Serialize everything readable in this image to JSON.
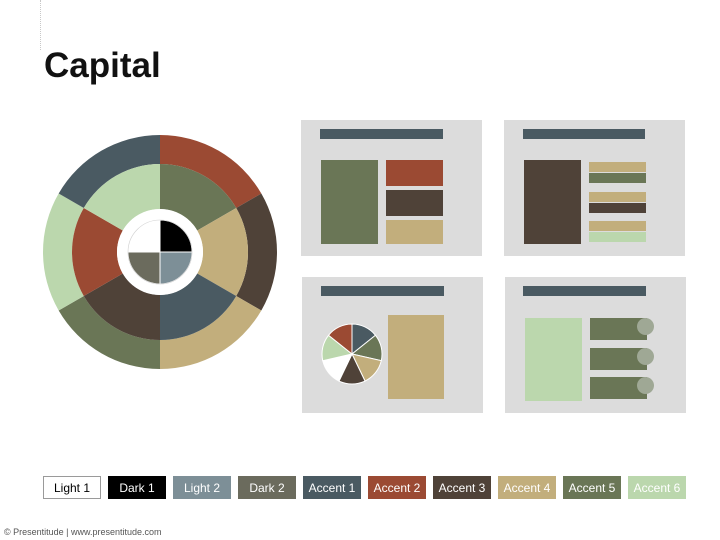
{
  "slide": {
    "title": "Capital"
  },
  "palette": {
    "light1": "#ffffff",
    "dark1": "#000000",
    "light2": "#7d8f97",
    "dark2": "#6b6b5d",
    "accent1": "#4a5a62",
    "accent2": "#9b4a33",
    "accent3": "#4f4238",
    "accent4": "#c2ae7c",
    "accent5": "#6a7656",
    "accent6": "#bbd7ad",
    "thumbnail_bg": "#dcdcdc"
  },
  "swatches": [
    {
      "label": "Light 1",
      "bg": "#ffffff",
      "fg": "#000000",
      "border": "#9a9a9a"
    },
    {
      "label": "Dark 1",
      "bg": "#000000",
      "fg": "#ffffff",
      "border": "#000000"
    },
    {
      "label": "Light 2",
      "bg": "#7d8f97",
      "fg": "#ffffff",
      "border": "#7d8f97"
    },
    {
      "label": "Dark 2",
      "bg": "#6b6b5d",
      "fg": "#ffffff",
      "border": "#6b6b5d"
    },
    {
      "label": "Accent 1",
      "bg": "#4a5a62",
      "fg": "#ffffff",
      "border": "#4a5a62"
    },
    {
      "label": "Accent 2",
      "bg": "#9b4a33",
      "fg": "#ffffff",
      "border": "#9b4a33"
    },
    {
      "label": "Accent 3",
      "bg": "#4f4238",
      "fg": "#ffffff",
      "border": "#4f4238"
    },
    {
      "label": "Accent 4",
      "bg": "#c2ae7c",
      "fg": "#ffffff",
      "border": "#c2ae7c"
    },
    {
      "label": "Accent 5",
      "bg": "#6a7656",
      "fg": "#ffffff",
      "border": "#6a7656"
    },
    {
      "label": "Accent 6",
      "bg": "#bbd7ad",
      "fg": "#ffffff",
      "border": "#bbd7ad"
    }
  ],
  "donut": {
    "outer_ring": [
      "#9b4a33",
      "#4f4238",
      "#c2ae7c",
      "#6a7656",
      "#bbd7ad",
      "#4a5a62"
    ],
    "middle_ring": [
      "#6a7656",
      "#c2ae7c",
      "#4a5a62",
      "#4f4238",
      "#9b4a33",
      "#bbd7ad"
    ],
    "center_quadrants": [
      "#000000",
      "#7d8f97",
      "#6b6b5d",
      "#ffffff"
    ]
  },
  "mini_pie": [
    "#4a5a62",
    "#6a7656",
    "#c2ae7c",
    "#4f4238",
    "#ffffff",
    "#bbd7ad",
    "#9b4a33"
  ],
  "footer": {
    "text": "© Presentitude | www.presentitude.com"
  }
}
